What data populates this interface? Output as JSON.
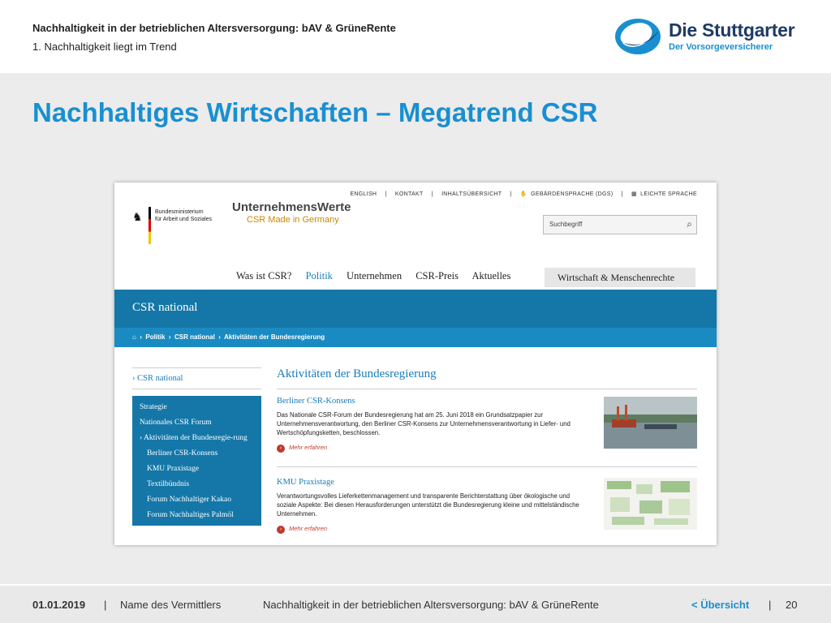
{
  "header": {
    "title": "Nachhaltigkeit in der betrieblichen Altersversorgung: bAV & GrüneRente",
    "subtitle": "1. Nachhaltigkeit liegt im Trend"
  },
  "logo": {
    "name": "Die Stuttgarter",
    "tagline": "Der Vorsorgeversicherer"
  },
  "slide_title": "Nachhaltiges Wirtschaften – Megatrend CSR",
  "website": {
    "utility_links": [
      "ENGLISH",
      "KONTAKT",
      "INHALTSÜBERSICHT",
      "GEBÄRDENSPRACHE (DGS)",
      "LEICHTE SPRACHE"
    ],
    "ministry": [
      "Bundesministerium",
      "für Arbeit und Soziales"
    ],
    "site_logo_main": "UnternehmensWerte",
    "site_logo_sub": "CSR Made in Germany",
    "search_placeholder": "Suchbegriff",
    "nav": [
      "Was ist CSR?",
      "Politik",
      "Unternehmen",
      "CSR-Preis",
      "Aktuelles"
    ],
    "nav_active": "Politik",
    "nav_tab": "Wirtschaft & Menschenrechte",
    "banner_title": "CSR national",
    "breadcrumb": [
      "Politik",
      "CSR national",
      "Aktivitäten der Bundesregierung"
    ],
    "sidebar_head": "CSR national",
    "sidebar_items": [
      "Strategie",
      "Nationales CSR Forum",
      "Aktivitäten der Bundesregie-rung",
      "Berliner CSR-Konsens",
      "KMU Praxistage",
      "Textilbündnis",
      "Forum Nachhaltiger Kakao",
      "Forum Nachhaltiges Palmöl"
    ],
    "main_title": "Aktivitäten der Bundesregierung",
    "articles": [
      {
        "title": "Berliner CSR-Konsens",
        "text": "Das Nationale CSR-Forum der Bundesregierung hat am 25. Juni 2018 ein Grundsatzpapier zur Unternehmensverantwortung, den Berliner CSR-Konsens zur Unternehmensverantwortung in Liefer- und Wertschöpfungsketten, beschlossen.",
        "more": "Mehr erfahren"
      },
      {
        "title": "KMU Praxistage",
        "text": "Verantwortungsvolles Lieferkettenmanagement und transparente Berichterstattung über ökologische und soziale Aspekte: Bei diesen Herausforderungen unterstützt die Bundesregierung kleine und mittelständische Unternehmen.",
        "more": "Mehr erfahren"
      }
    ]
  },
  "footer": {
    "date": "01.01.2019",
    "separator": "|",
    "agent": "Name des Vermittlers",
    "title": "Nachhaltigkeit in der betrieblichen Altersversorgung: bAV & GrüneRente",
    "overview": "< Übersicht",
    "page": "20"
  }
}
